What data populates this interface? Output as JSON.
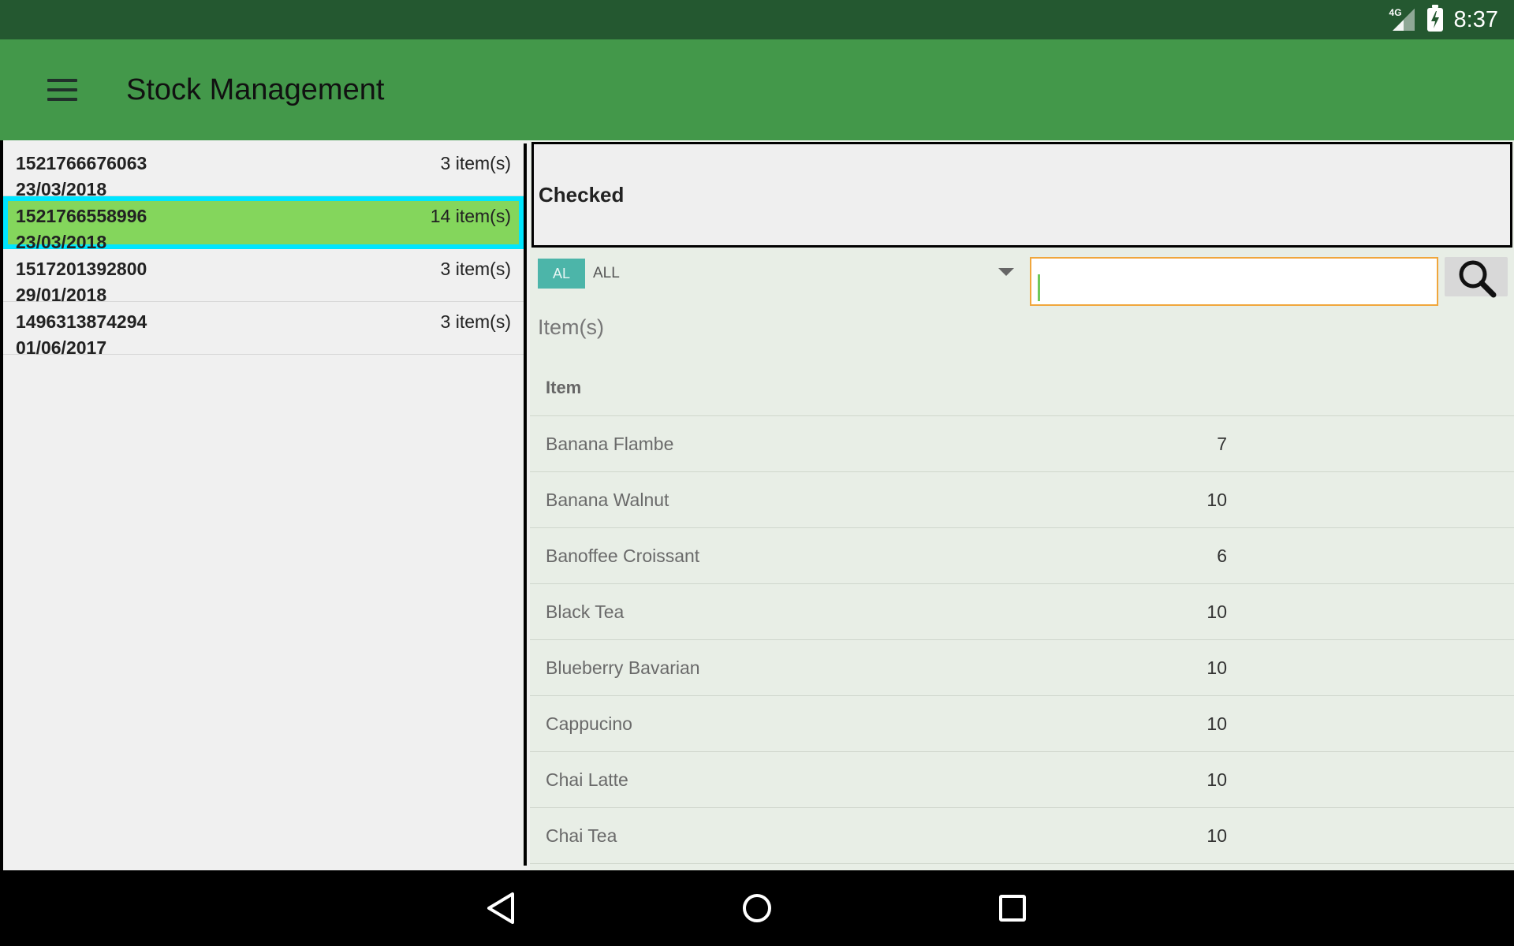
{
  "status_bar": {
    "network": "4G",
    "time": "8:37"
  },
  "app_bar": {
    "title": "Stock Management"
  },
  "documents": [
    {
      "id": "1521766676063",
      "date": "23/03/2018",
      "count": "3 item(s)",
      "selected": false
    },
    {
      "id": "1521766558996",
      "date": "23/03/2018",
      "count": "14 item(s)",
      "selected": true
    },
    {
      "id": "1517201392800",
      "date": "29/01/2018",
      "count": "3 item(s)",
      "selected": false
    },
    {
      "id": "1496313874294",
      "date": "01/06/2017",
      "count": "3 item(s)",
      "selected": false
    }
  ],
  "detail": {
    "status_label": "Checked",
    "filter": {
      "chip": "AL",
      "selected": "ALL"
    },
    "search": {
      "value": "",
      "placeholder": ""
    },
    "section_title": "Item(s)",
    "table": {
      "header": "Item",
      "rows": [
        {
          "name": "Banana Flambe",
          "qty": "7"
        },
        {
          "name": "Banana Walnut",
          "qty": "10"
        },
        {
          "name": "Banoffee Croissant",
          "qty": "6"
        },
        {
          "name": "Black Tea",
          "qty": "10"
        },
        {
          "name": "Blueberry Bavarian",
          "qty": "10"
        },
        {
          "name": "Cappucino",
          "qty": "10"
        },
        {
          "name": "Chai Latte",
          "qty": "10"
        },
        {
          "name": "Chai Tea",
          "qty": "10"
        }
      ]
    }
  },
  "colors": {
    "status_bar": "#245830",
    "app_bar": "#43984a",
    "selected_row": "#84d65c",
    "selected_outline": "#00e5ff",
    "chip": "#4cb5a9",
    "search_border": "#f0a63c"
  },
  "icons": {
    "menu": "hamburger-icon",
    "search": "magnifier-icon",
    "back": "triangle-back-icon",
    "home": "circle-home-icon",
    "recents": "square-recents-icon"
  }
}
